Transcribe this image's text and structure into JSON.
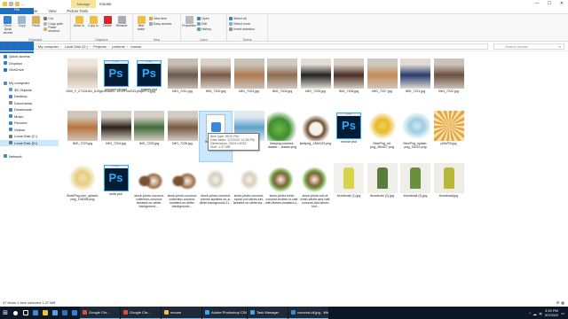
{
  "window": {
    "title": "mouse",
    "tool_tab": "Manage",
    "minimize": "—",
    "maximize": "☐",
    "close": "✕"
  },
  "tabs": [
    "File",
    "Home",
    "Share",
    "View",
    "Picture Tools"
  ],
  "ribbon": {
    "clipboard": {
      "name": "Clipboard",
      "pin": "Pin to Quick access",
      "copy": "Copy",
      "paste": "Paste",
      "cut": "Cut",
      "copy_path": "Copy path",
      "paste_shortcut": "Paste shortcut"
    },
    "organize": {
      "name": "Organize",
      "move_to": "Move to",
      "copy_to": "Copy to",
      "delete": "Delete",
      "rename": "Rename"
    },
    "new": {
      "name": "New",
      "new_folder": "New folder",
      "new_item": "New item",
      "easy_access": "Easy access"
    },
    "open": {
      "name": "Open",
      "properties": "Properties",
      "open": "Open",
      "edit": "Edit",
      "history": "History"
    },
    "select": {
      "name": "Select",
      "select_all": "Select all",
      "select_none": "Select none",
      "invert": "Invert selection"
    }
  },
  "address": {
    "back": "←",
    "forward": "→",
    "recent": "⌄",
    "up": "↑",
    "parts": [
      "My computer",
      "Local Disk (D:)",
      "Projects",
      "perfume",
      "mouse"
    ],
    "search_placeholder": "Search mouse"
  },
  "nav": [
    {
      "label": "Quick access",
      "icon": "star-icon",
      "color": "#3b82c4",
      "indent": 0
    },
    {
      "label": "Dropbox",
      "icon": "dropbox-icon",
      "color": "#2f7fe0",
      "indent": 0
    },
    {
      "label": "OneDrive",
      "icon": "cloud-icon",
      "color": "#2a6fc0",
      "indent": 0
    },
    {
      "label": "",
      "icon": "",
      "color": "",
      "indent": 0
    },
    {
      "label": "My computer",
      "icon": "computer-icon",
      "color": "#4a90c8",
      "indent": 0
    },
    {
      "label": "3D Objects",
      "icon": "cube-icon",
      "color": "#5aa0d8",
      "indent": 1
    },
    {
      "label": "Desktop",
      "icon": "desktop-icon",
      "color": "#3f88cc",
      "indent": 1
    },
    {
      "label": "Documents",
      "icon": "documents-icon",
      "color": "#8a8a8a",
      "indent": 1
    },
    {
      "label": "Downloads",
      "icon": "download-icon",
      "color": "#3f88cc",
      "indent": 1
    },
    {
      "label": "Music",
      "icon": "music-icon",
      "color": "#3f88cc",
      "indent": 1
    },
    {
      "label": "Pictures",
      "icon": "pictures-icon",
      "color": "#3f88cc",
      "indent": 1
    },
    {
      "label": "Videos",
      "icon": "videos-icon",
      "color": "#3f88cc",
      "indent": 1
    },
    {
      "label": "Local Disk (C:)",
      "icon": "drive-icon",
      "color": "#777777",
      "indent": 1
    },
    {
      "label": "Local Disk (D:)",
      "icon": "drive-icon",
      "color": "#777777",
      "indent": 1,
      "selected": true
    },
    {
      "label": "",
      "icon": "",
      "color": "",
      "indent": 0
    },
    {
      "label": "Network",
      "icon": "network-icon",
      "color": "#3f88cc",
      "indent": 0
    }
  ],
  "files": [
    {
      "name": "1000_F_27125161_6JZgkvR5adN...bXVfFVoiOZLp0q6PCcj.jpg",
      "kind": "photo",
      "colors": [
        "#efe7dd",
        "#c9b8a6"
      ]
    },
    {
      "name": "coconut-oil.psd",
      "kind": "psd"
    },
    {
      "name": "enliven.psd",
      "kind": "psd"
    },
    {
      "name": "IMG_7201.jpg",
      "kind": "photo",
      "colors": [
        "#c7bfb4",
        "#6b5a4c"
      ]
    },
    {
      "name": "IMG_7202.jpg",
      "kind": "photo",
      "colors": [
        "#d8d1c7",
        "#7a5b45"
      ]
    },
    {
      "name": "IMG_7203.jpg",
      "kind": "photo",
      "colors": [
        "#c9c2b8",
        "#b07a52"
      ]
    },
    {
      "name": "IMG_7204.jpg",
      "kind": "photo",
      "colors": [
        "#d1cbc3",
        "#8e6b4e"
      ]
    },
    {
      "name": "IMG_7205.jpg",
      "kind": "photo",
      "colors": [
        "#e2ddd5",
        "#222222"
      ]
    },
    {
      "name": "IMG_7206.jpg",
      "kind": "photo",
      "colors": [
        "#d6d0c8",
        "#4a2f22"
      ]
    },
    {
      "name": "IMG_7207.jpg",
      "kind": "photo",
      "colors": [
        "#cfc8bf",
        "#c38b5a"
      ]
    },
    {
      "name": "IMG_7221.jpg",
      "kind": "photo",
      "colors": [
        "#e0dbd4",
        "#2a3b6e"
      ]
    },
    {
      "name": "IMG_7222.jpg",
      "kind": "photo",
      "colors": [
        "#cac3ba",
        "#6d5140"
      ]
    },
    {
      "name": "IMG_7223.jpg",
      "kind": "photo",
      "colors": [
        "#d2c6b8",
        "#b8743f"
      ]
    },
    {
      "name": "IMG_7224.jpg",
      "kind": "photo",
      "colors": [
        "#d4cec5",
        "#2b2118"
      ]
    },
    {
      "name": "IMG_7225.jpg",
      "kind": "photo",
      "colors": [
        "#d6cfc6",
        "#3f6b38"
      ]
    },
    {
      "name": "IMG_7226.jpg",
      "kind": "photo",
      "colors": [
        "#d3ccc3",
        "#7a5a42"
      ]
    },
    {
      "name": "IMG_7227.heic",
      "kind": "heic",
      "selected": true
    },
    {
      "name": "IMG_7228.jpg",
      "kind": "photo",
      "colors": [
        "#dfe9f0",
        "#5fa2cc"
      ]
    },
    {
      "name": "kisspng-coconut-dwater-...leaves.png",
      "kind": "leaf"
    },
    {
      "name": "kindpng_1384193.png",
      "kind": "coconut"
    },
    {
      "name": "mouse.psd",
      "kind": "psd"
    },
    {
      "name": "NicePng_oil-png_364427.png",
      "kind": "oil"
    },
    {
      "name": "NicePng_splash-png_32022.png",
      "kind": "splash"
    },
    {
      "name": "pt3nP0l.jpg",
      "kind": "rays"
    },
    {
      "name": "SeekPng.com_splash-png_134058.png",
      "kind": "splash2"
    },
    {
      "name": "soda.psd",
      "kind": "psd"
    },
    {
      "name": "stock-photo-coconut-collection-coconut-isolated-on-white-background-...",
      "kind": "coco2"
    },
    {
      "name": "stock-photo-coconut-collection-coconut-isolated-on-white-background-...",
      "kind": "coco2"
    },
    {
      "name": "stock-photo-coconut-pieces-isolated-on-a-white-background-21...",
      "kind": "coco3"
    },
    {
      "name": "stock-photo-coconut-spiral-curl-slices-set-isolated-on-white-ba...",
      "kind": "coco3"
    },
    {
      "name": "stock-photo-fresh-coconut-broken-in-half-with-leaves-isolated-o...",
      "kind": "coco4"
    },
    {
      "name": "stock-photo-set-of-fresh-whole-and-half-coconut-and-slices-isol...",
      "kind": "coco4"
    },
    {
      "name": "thumbnail (1).jpg",
      "kind": "bottle",
      "colors": [
        "#f2f0ec",
        "#d7d34a"
      ]
    },
    {
      "name": "thumbnail (2).jpg",
      "kind": "bottle",
      "colors": [
        "#f0efe9",
        "#5a7c3a"
      ]
    },
    {
      "name": "thumbnail (3).jpg",
      "kind": "bottle",
      "colors": [
        "#efeee8",
        "#6a8f3f"
      ]
    },
    {
      "name": "thumbnail.jpg",
      "kind": "bottle",
      "colors": [
        "#efece6",
        "#b7b73a"
      ]
    }
  ],
  "tooltip": {
    "type": "Item type: HEIC File",
    "date": "Date taken: 3/7/2022 12:38 PM",
    "dimensions": "Dimensions: 3024 x 4032",
    "size": "Size: 1.37 MB"
  },
  "status": {
    "text": "37 items    1 item selected  1.37 MB",
    "view_details": "☰",
    "view_icons": "▦"
  },
  "taskbar": {
    "start": "⊞",
    "tasks": [
      {
        "label": "Google Chr...",
        "icon": "chrome-icon",
        "color": "#e24a3b"
      },
      {
        "label": "Google Chr...",
        "icon": "chrome-icon",
        "color": "#e24a3b"
      },
      {
        "label": "mouse",
        "icon": "folder-icon",
        "color": "#f0c040"
      },
      {
        "label": "Adobe Photoshop CS6",
        "icon": "photoshop-icon",
        "color": "#31a8ff"
      },
      {
        "label": "Task Manager",
        "icon": "taskmanager-icon",
        "color": "#4aa3df"
      },
      {
        "label": "coconut-oil.jpg - Win...",
        "icon": "photo-icon",
        "color": "#3b8ad8"
      }
    ],
    "clock_time": "3:39 PM",
    "clock_date": "3/7/2022"
  }
}
